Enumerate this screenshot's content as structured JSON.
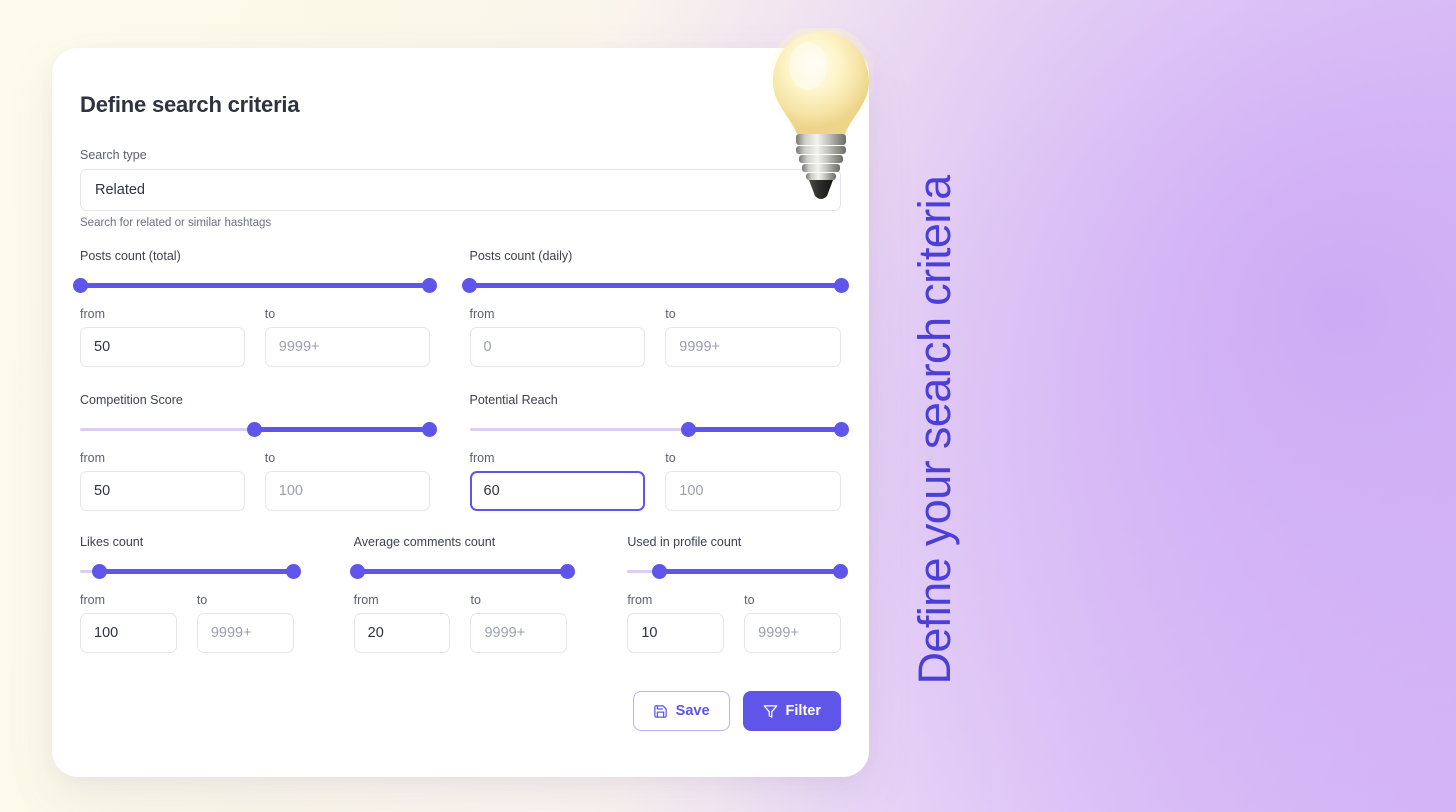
{
  "theme": {
    "accent": "#5f55e8",
    "accent_deep": "#4b3fd6",
    "track_inactive": "#ddcdf2",
    "card_bg": "#ffffff",
    "text_dark": "#2e3340",
    "text_muted": "#5c6170",
    "placeholder": "#9ba0ae"
  },
  "card": {
    "title": "Define search criteria",
    "search_type": {
      "label": "Search type",
      "value": "Related",
      "help": "Search for related or similar hashtags"
    },
    "groups": [
      {
        "name": "posts-count-total",
        "title": "Posts count (total)",
        "slider": {
          "fill_start_pct": 0,
          "fill_end_pct": 100
        },
        "from": {
          "label": "from",
          "value": "50",
          "placeholder": "",
          "focused": false
        },
        "to": {
          "label": "to",
          "value": "",
          "placeholder": "9999+",
          "focused": false
        }
      },
      {
        "name": "posts-count-daily",
        "title": "Posts count (daily)",
        "slider": {
          "fill_start_pct": 0,
          "fill_end_pct": 100
        },
        "from": {
          "label": "from",
          "value": "",
          "placeholder": "0",
          "focused": false
        },
        "to": {
          "label": "to",
          "value": "",
          "placeholder": "9999+",
          "focused": false
        }
      },
      {
        "name": "competition-score",
        "title": "Competition Score",
        "slider": {
          "fill_start_pct": 50,
          "fill_end_pct": 100
        },
        "from": {
          "label": "from",
          "value": "50",
          "placeholder": "",
          "focused": false
        },
        "to": {
          "label": "to",
          "value": "",
          "placeholder": "100",
          "focused": false
        }
      },
      {
        "name": "potential-reach",
        "title": "Potential Reach",
        "slider": {
          "fill_start_pct": 59,
          "fill_end_pct": 100
        },
        "from": {
          "label": "from",
          "value": "60",
          "placeholder": "",
          "focused": true
        },
        "to": {
          "label": "to",
          "value": "",
          "placeholder": "100",
          "focused": false
        }
      },
      {
        "name": "likes-count",
        "title": "Likes count",
        "slider": {
          "fill_start_pct": 9,
          "fill_end_pct": 100
        },
        "from": {
          "label": "from",
          "value": "100",
          "placeholder": "",
          "focused": false
        },
        "to": {
          "label": "to",
          "value": "",
          "placeholder": "9999+",
          "focused": false
        }
      },
      {
        "name": "average-comments-count",
        "title": "Average comments count",
        "slider": {
          "fill_start_pct": 2,
          "fill_end_pct": 100
        },
        "from": {
          "label": "from",
          "value": "20",
          "placeholder": "",
          "focused": false
        },
        "to": {
          "label": "to",
          "value": "",
          "placeholder": "9999+",
          "focused": false
        }
      },
      {
        "name": "used-in-profile-count",
        "title": "Used in profile count",
        "slider": {
          "fill_start_pct": 15,
          "fill_end_pct": 100
        },
        "from": {
          "label": "from",
          "value": "10",
          "placeholder": "",
          "focused": false
        },
        "to": {
          "label": "to",
          "value": "",
          "placeholder": "9999+",
          "focused": false
        }
      }
    ],
    "actions": {
      "save_label": "Save",
      "save_icon": "save-floppy-icon",
      "filter_label": "Filter",
      "filter_icon": "funnel-icon"
    }
  },
  "decor": {
    "bulb_icon": "lightbulb-illustration",
    "headline": "Define your search criteria"
  }
}
